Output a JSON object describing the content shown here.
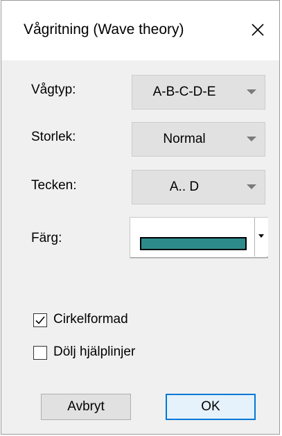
{
  "window": {
    "title": "Vågritning (Wave theory)"
  },
  "fields": {
    "wave_type": {
      "label": "Vågtyp:",
      "value": "A-B-C-D-E"
    },
    "size": {
      "label": "Storlek:",
      "value": "Normal"
    },
    "signs": {
      "label": "Tecken:",
      "value": "A.. D"
    },
    "color": {
      "label": "Färg:",
      "value": "#2e8b8b"
    }
  },
  "checkboxes": {
    "circle_shaped": {
      "label": "Cirkelformad",
      "checked": true
    },
    "hide_helplines": {
      "label": "Dölj hjälplinjer",
      "checked": false
    }
  },
  "buttons": {
    "cancel": "Avbryt",
    "ok": "OK"
  },
  "colors": {
    "accent": "#0078d7",
    "dialog_bg": "#f0f0f0",
    "combo_bg": "#e1e1e1",
    "selected_color": "#2e8b8b"
  },
  "icons": {
    "close": "close-icon",
    "checkmark": "checkmark-icon",
    "dropdown": "chevron-down-icon"
  }
}
